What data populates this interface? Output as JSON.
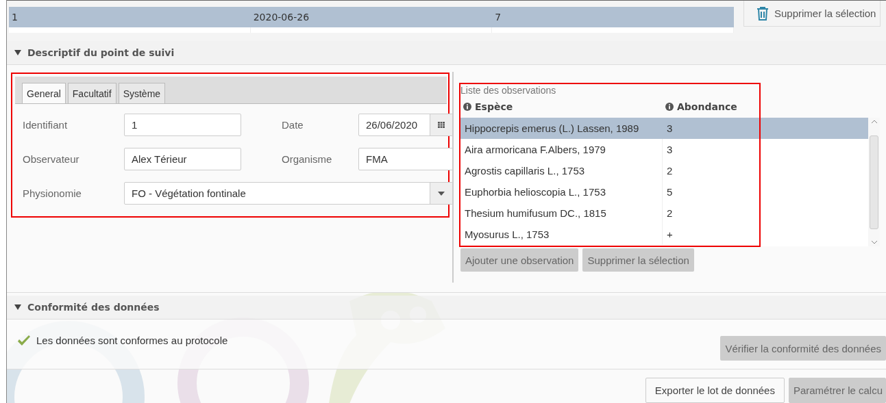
{
  "top_table": {
    "rows": [
      {
        "cells": [
          "1",
          "2020-06-26",
          "7"
        ],
        "selected": true
      }
    ],
    "delete_button": {
      "label": "Supprimer la sélection"
    }
  },
  "descriptif": {
    "title": "Descriptif du point de suivi",
    "expanded": true,
    "tabs": [
      {
        "label": "General",
        "selected": true
      },
      {
        "label": "Facultatif",
        "selected": false
      },
      {
        "label": "Système",
        "selected": false
      }
    ],
    "fields": [
      {
        "label": "Identifiant",
        "value": "1",
        "kind": "text"
      },
      {
        "label": "Date",
        "value": "26/06/2020",
        "kind": "date"
      },
      {
        "label": "Observateur",
        "value": "Alex Térieur",
        "kind": "text"
      },
      {
        "label": "Organisme",
        "value": "FMA",
        "kind": "text"
      },
      {
        "label": "Physionomie",
        "value": "FO - Végétation fontinale",
        "kind": "select"
      }
    ],
    "observations": {
      "label": "Liste des observations",
      "columns": [
        "Espèce",
        "Abondance"
      ],
      "rows": [
        {
          "species": "Hippocrepis emerus (L.) Lassen, 1989",
          "abundance": "3",
          "selected": true
        },
        {
          "species": "Aira armoricana F.Albers, 1979",
          "abundance": "3",
          "selected": false
        },
        {
          "species": "Agrostis capillaris L., 1753",
          "abundance": "2",
          "selected": false
        },
        {
          "species": "Euphorbia helioscopia L., 1753",
          "abundance": "5",
          "selected": false
        },
        {
          "species": "Thesium humifusum DC., 1815",
          "abundance": "2",
          "selected": false
        },
        {
          "species": "Myosurus L., 1753",
          "abundance": "+",
          "selected": false
        }
      ],
      "buttons": [
        {
          "label": "Ajouter une observation",
          "disabled": true
        },
        {
          "label": "Supprimer la sélection",
          "disabled": true
        }
      ]
    }
  },
  "conformite": {
    "title": "Conformité des données",
    "expanded": true,
    "valid": true,
    "message": "Les données sont conformes au protocole",
    "button": {
      "label": "Vérifier la conformité des données",
      "disabled": true
    }
  },
  "footer_buttons": [
    {
      "label": "Exporter le lot de données",
      "disabled": false
    },
    {
      "label": "Paramétrer le calcu",
      "disabled": true
    }
  ]
}
